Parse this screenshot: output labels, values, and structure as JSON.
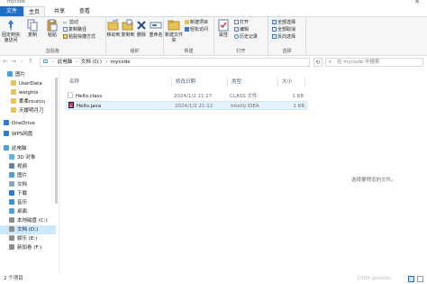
{
  "window": {
    "title": "mycode"
  },
  "tabs": [
    "文件",
    "主页",
    "共享",
    "查看"
  ],
  "ribbon": {
    "clipboard": {
      "label": "剪贴板",
      "pin": "固定到快速访问",
      "copy": "复制",
      "paste": "粘贴",
      "cut": "剪切",
      "copy_path": "复制路径",
      "paste_shortcut": "粘贴快捷方式"
    },
    "organize": {
      "label": "组织",
      "move_to": "移动到",
      "copy_to": "复制到",
      "delete": "删除",
      "rename": "重命名"
    },
    "new": {
      "label": "新建",
      "new_folder": "新建文件夹",
      "new_item": "新建项目",
      "easy_access": "轻松访问"
    },
    "open": {
      "label": "打开",
      "properties": "属性",
      "open": "打开",
      "edit": "编辑",
      "history": "历史记录"
    },
    "select": {
      "label": "选择",
      "select_all": "全部选择",
      "select_none": "全部取消",
      "invert": "反向选择"
    }
  },
  "address": {
    "segments": [
      "此电脑",
      "文档 (D:)",
      "mycode"
    ],
    "search_placeholder": "在 mycode 中搜索"
  },
  "nav": {
    "items": [
      {
        "label": "图片",
        "icon": "pictures-icon",
        "color": "#4aa3df"
      },
      {
        "label": "UserData",
        "icon": "folder-icon",
        "color": "#e8c15a"
      },
      {
        "label": "weights",
        "icon": "folder-icon",
        "color": "#e8c15a"
      },
      {
        "label": "柔柔rourou",
        "icon": "folder-icon",
        "color": "#e8c15a"
      },
      {
        "label": "天媛明月刀",
        "icon": "folder-icon",
        "color": "#e8c15a"
      },
      {
        "label": "OneDrive",
        "icon": "cloud-icon",
        "color": "#2b7cd3"
      },
      {
        "label": "WPS网盘",
        "icon": "cloud-icon",
        "color": "#2b7cd3"
      },
      {
        "label": "此电脑",
        "icon": "computer-icon",
        "color": "#4aa3df"
      },
      {
        "label": "3D 对象",
        "icon": "3d-objects-icon",
        "color": "#5bb6e8"
      },
      {
        "label": "视频",
        "icon": "videos-icon",
        "color": "#6b7fa0"
      },
      {
        "label": "图片",
        "icon": "pictures-icon",
        "color": "#4aa3df"
      },
      {
        "label": "文档",
        "icon": "documents-icon",
        "color": "#8aa4c1"
      },
      {
        "label": "下载",
        "icon": "downloads-icon",
        "color": "#2b7cd3"
      },
      {
        "label": "音乐",
        "icon": "music-icon",
        "color": "#3b8ed8"
      },
      {
        "label": "桌面",
        "icon": "desktop-icon",
        "color": "#4aa3df"
      },
      {
        "label": "本地磁盘 (C:)",
        "icon": "drive-icon",
        "color": "#8c8c8c"
      },
      {
        "label": "文档 (D:)",
        "icon": "drive-icon",
        "color": "#8c8c8c"
      },
      {
        "label": "娱乐 (E:)",
        "icon": "drive-icon",
        "color": "#8c8c8c"
      },
      {
        "label": "新加卷 (F:)",
        "icon": "drive-icon",
        "color": "#8c8c8c"
      }
    ]
  },
  "list": {
    "columns": [
      "名称",
      "修改日期",
      "类型",
      "大小"
    ],
    "rows": [
      {
        "name": "Hello.class",
        "date": "2024/1/2 21:17",
        "type": "CLASS 文件",
        "size": "1 KB",
        "icon": "class-file-icon"
      },
      {
        "name": "Hello.java",
        "date": "2024/1/2 21:12",
        "type": "IntelliJ IDEA",
        "size": "1 KB",
        "icon": "java-file-icon"
      }
    ],
    "preview_hint": "选择要预览的文件。"
  },
  "status": {
    "count": "2 个项目",
    "watermark": "CSDN @rourou"
  },
  "colors": {
    "accent": "#1e6fc5",
    "selection": "#cce8ff"
  }
}
